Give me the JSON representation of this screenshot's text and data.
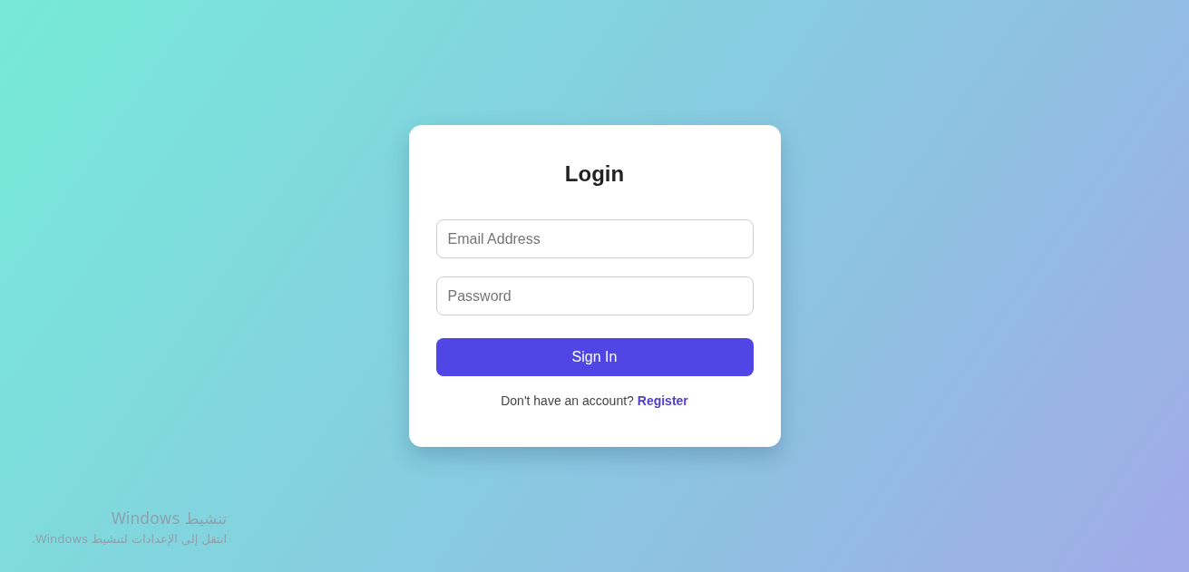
{
  "card": {
    "title": "Login",
    "email_field": {
      "placeholder": "Email Address"
    },
    "password_field": {
      "placeholder": "Password"
    },
    "submit": {
      "label": "Sign In"
    },
    "footer": {
      "prompt": "Don't have an account?",
      "link": "Register"
    }
  },
  "activation_notice": {
    "title": "تنشيط Windows",
    "message": "انتقل إلى الإعدادات لتنشيط Windows."
  }
}
